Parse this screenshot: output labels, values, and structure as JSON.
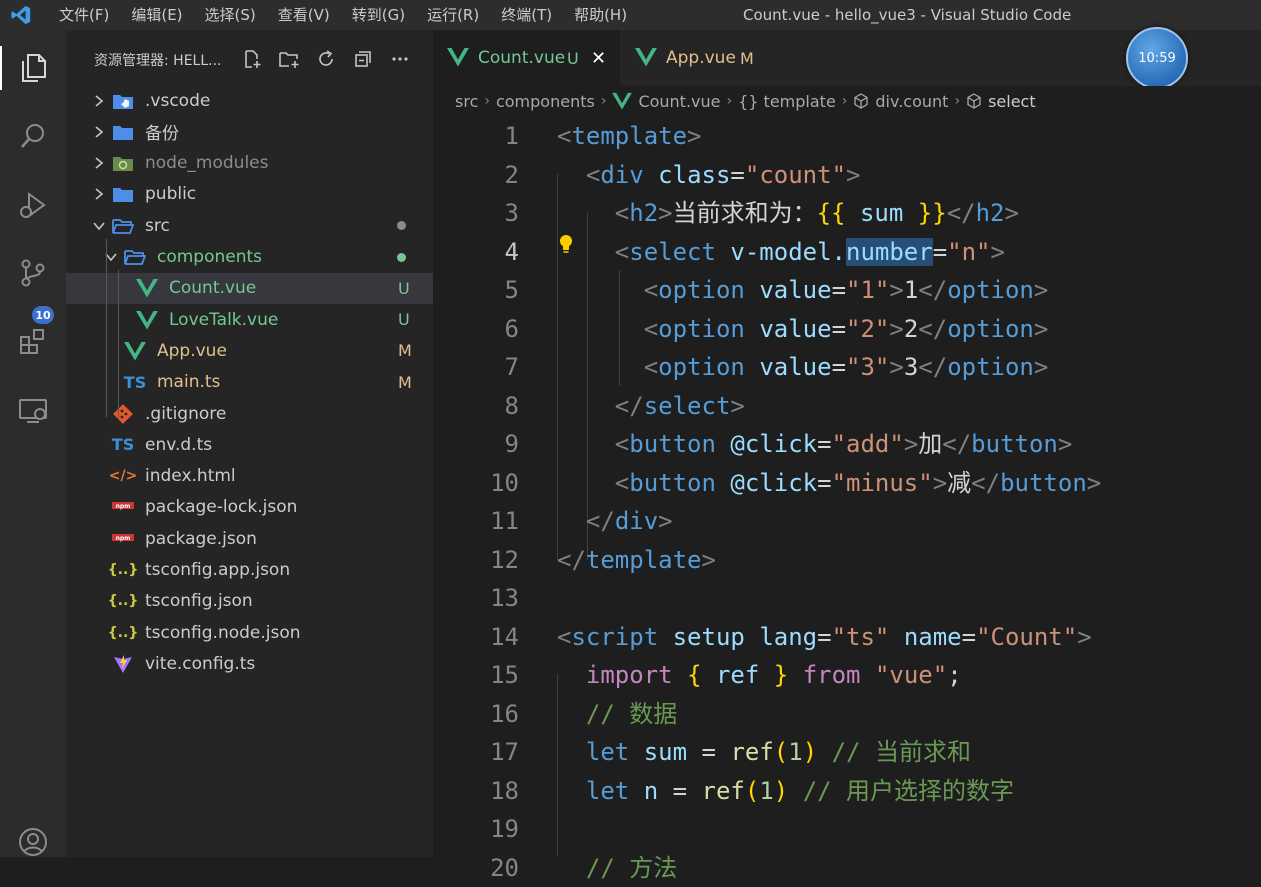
{
  "titlebar": {
    "menu": [
      "文件(F)",
      "编辑(E)",
      "选择(S)",
      "查看(V)",
      "转到(G)",
      "运行(R)",
      "终端(T)",
      "帮助(H)"
    ],
    "window_title": "Count.vue - hello_vue3 - Visual Studio Code"
  },
  "activitybar": {
    "icons": [
      "explorer-icon",
      "search-icon",
      "run-debug-icon",
      "source-control-icon",
      "extensions-icon",
      "remote-explorer-icon",
      "accounts-icon"
    ],
    "scm_badge": "10"
  },
  "sidebar": {
    "title": "资源管理器: HELL...",
    "tree": [
      {
        "label": ".vscode",
        "kind": "folder",
        "icon": "vscode-folder-icon",
        "status": ""
      },
      {
        "label": "备份",
        "kind": "folder",
        "icon": "folder-icon",
        "status": ""
      },
      {
        "label": "node_modules",
        "kind": "folder",
        "icon": "node-folder-icon",
        "status": ""
      },
      {
        "label": "public",
        "kind": "folder",
        "icon": "folder-icon",
        "status": ""
      },
      {
        "label": "src",
        "kind": "folder-open",
        "icon": "folder-open-icon",
        "status": "dot"
      },
      {
        "label": "components",
        "kind": "folder-open",
        "icon": "folder-open-icon",
        "status": "dot"
      },
      {
        "label": "Count.vue",
        "kind": "file",
        "icon": "vue-icon",
        "status": "U"
      },
      {
        "label": "LoveTalk.vue",
        "kind": "file",
        "icon": "vue-icon",
        "status": "U"
      },
      {
        "label": "App.vue",
        "kind": "file",
        "icon": "vue-icon",
        "status": "M"
      },
      {
        "label": "main.ts",
        "kind": "file",
        "icon": "ts-icon",
        "status": "M"
      },
      {
        "label": ".gitignore",
        "kind": "file",
        "icon": "git-icon",
        "status": ""
      },
      {
        "label": "env.d.ts",
        "kind": "file",
        "icon": "ts-icon",
        "status": ""
      },
      {
        "label": "index.html",
        "kind": "file",
        "icon": "html-icon",
        "status": ""
      },
      {
        "label": "package-lock.json",
        "kind": "file",
        "icon": "npm-icon",
        "status": ""
      },
      {
        "label": "package.json",
        "kind": "file",
        "icon": "npm-icon",
        "status": ""
      },
      {
        "label": "tsconfig.app.json",
        "kind": "file",
        "icon": "json-icon",
        "status": ""
      },
      {
        "label": "tsconfig.json",
        "kind": "file",
        "icon": "json-icon",
        "status": ""
      },
      {
        "label": "tsconfig.node.json",
        "kind": "file",
        "icon": "json-icon",
        "status": ""
      },
      {
        "label": "vite.config.ts",
        "kind": "file",
        "icon": "vite-icon",
        "status": ""
      }
    ],
    "selected": "Count.vue"
  },
  "tabs": [
    {
      "label": "Count.vue",
      "status": "U",
      "close": "✕",
      "active": true
    },
    {
      "label": "App.vue",
      "status": "M",
      "active": false
    }
  ],
  "breadcrumb": [
    "src",
    "components",
    "Count.vue",
    "{} template",
    "div.count",
    "select"
  ],
  "clock": "10:59",
  "editor": {
    "current_line": 4,
    "lines": [
      {
        "n": "1",
        "tokens": [
          [
            "bracket",
            "<"
          ],
          [
            "tag",
            "template"
          ],
          [
            "bracket",
            ">"
          ]
        ]
      },
      {
        "n": "2",
        "tokens": [
          [
            "op",
            "  "
          ],
          [
            "bracket",
            "<"
          ],
          [
            "tag",
            "div"
          ],
          [
            "op",
            " "
          ],
          [
            "attr",
            "class"
          ],
          [
            "op",
            "="
          ],
          [
            "str",
            "\"count\""
          ],
          [
            "bracket",
            ">"
          ]
        ]
      },
      {
        "n": "3",
        "tokens": [
          [
            "op",
            "    "
          ],
          [
            "bracket",
            "<"
          ],
          [
            "tag",
            "h2"
          ],
          [
            "bracket",
            ">"
          ],
          [
            "op",
            "当前求和为："
          ],
          [
            "brace",
            "{{"
          ],
          [
            "op",
            " "
          ],
          [
            "var",
            "sum"
          ],
          [
            "op",
            " "
          ],
          [
            "brace",
            "}}"
          ],
          [
            "bracket",
            "</"
          ],
          [
            "tag",
            "h2"
          ],
          [
            "bracket",
            ">"
          ]
        ]
      },
      {
        "n": "4",
        "tokens": [
          [
            "op",
            "    "
          ],
          [
            "bracket",
            "<"
          ],
          [
            "tag",
            "select"
          ],
          [
            "op",
            " "
          ],
          [
            "attr",
            "v-model."
          ],
          [
            "sel",
            "number"
          ],
          [
            "op",
            "="
          ],
          [
            "str",
            "\"n\""
          ],
          [
            "bracket",
            ">"
          ]
        ]
      },
      {
        "n": "5",
        "tokens": [
          [
            "op",
            "      "
          ],
          [
            "bracket",
            "<"
          ],
          [
            "tag",
            "option"
          ],
          [
            "op",
            " "
          ],
          [
            "attr",
            "value"
          ],
          [
            "op",
            "="
          ],
          [
            "str",
            "\"1\""
          ],
          [
            "bracket",
            ">"
          ],
          [
            "op",
            "1"
          ],
          [
            "bracket",
            "</"
          ],
          [
            "tag",
            "option"
          ],
          [
            "bracket",
            ">"
          ]
        ]
      },
      {
        "n": "6",
        "tokens": [
          [
            "op",
            "      "
          ],
          [
            "bracket",
            "<"
          ],
          [
            "tag",
            "option"
          ],
          [
            "op",
            " "
          ],
          [
            "attr",
            "value"
          ],
          [
            "op",
            "="
          ],
          [
            "str",
            "\"2\""
          ],
          [
            "bracket",
            ">"
          ],
          [
            "op",
            "2"
          ],
          [
            "bracket",
            "</"
          ],
          [
            "tag",
            "option"
          ],
          [
            "bracket",
            ">"
          ]
        ]
      },
      {
        "n": "7",
        "tokens": [
          [
            "op",
            "      "
          ],
          [
            "bracket",
            "<"
          ],
          [
            "tag",
            "option"
          ],
          [
            "op",
            " "
          ],
          [
            "attr",
            "value"
          ],
          [
            "op",
            "="
          ],
          [
            "str",
            "\"3\""
          ],
          [
            "bracket",
            ">"
          ],
          [
            "op",
            "3"
          ],
          [
            "bracket",
            "</"
          ],
          [
            "tag",
            "option"
          ],
          [
            "bracket",
            ">"
          ]
        ]
      },
      {
        "n": "8",
        "tokens": [
          [
            "op",
            "    "
          ],
          [
            "bracket",
            "</"
          ],
          [
            "tag",
            "select"
          ],
          [
            "bracket",
            ">"
          ]
        ]
      },
      {
        "n": "9",
        "tokens": [
          [
            "op",
            "    "
          ],
          [
            "bracket",
            "<"
          ],
          [
            "tag",
            "button"
          ],
          [
            "op",
            " "
          ],
          [
            "attr",
            "@click"
          ],
          [
            "op",
            "="
          ],
          [
            "str",
            "\"add\""
          ],
          [
            "bracket",
            ">"
          ],
          [
            "op",
            "加"
          ],
          [
            "bracket",
            "</"
          ],
          [
            "tag",
            "button"
          ],
          [
            "bracket",
            ">"
          ]
        ]
      },
      {
        "n": "10",
        "tokens": [
          [
            "op",
            "    "
          ],
          [
            "bracket",
            "<"
          ],
          [
            "tag",
            "button"
          ],
          [
            "op",
            " "
          ],
          [
            "attr",
            "@click"
          ],
          [
            "op",
            "="
          ],
          [
            "str",
            "\"minus\""
          ],
          [
            "bracket",
            ">"
          ],
          [
            "op",
            "减"
          ],
          [
            "bracket",
            "</"
          ],
          [
            "tag",
            "button"
          ],
          [
            "bracket",
            ">"
          ]
        ]
      },
      {
        "n": "11",
        "tokens": [
          [
            "op",
            "  "
          ],
          [
            "bracket",
            "</"
          ],
          [
            "tag",
            "div"
          ],
          [
            "bracket",
            ">"
          ]
        ]
      },
      {
        "n": "12",
        "tokens": [
          [
            "bracket",
            "</"
          ],
          [
            "tag",
            "template"
          ],
          [
            "bracket",
            ">"
          ]
        ]
      },
      {
        "n": "13",
        "tokens": []
      },
      {
        "n": "14",
        "tokens": [
          [
            "bracket",
            "<"
          ],
          [
            "tag",
            "script"
          ],
          [
            "op",
            " "
          ],
          [
            "attr",
            "setup"
          ],
          [
            "op",
            " "
          ],
          [
            "attr",
            "lang"
          ],
          [
            "op",
            "="
          ],
          [
            "str",
            "\"ts\""
          ],
          [
            "op",
            " "
          ],
          [
            "attr",
            "name"
          ],
          [
            "op",
            "="
          ],
          [
            "str",
            "\"Count\""
          ],
          [
            "bracket",
            ">"
          ]
        ]
      },
      {
        "n": "15",
        "tokens": [
          [
            "op",
            "  "
          ],
          [
            "kw",
            "import"
          ],
          [
            "op",
            " "
          ],
          [
            "brace",
            "{"
          ],
          [
            "op",
            " "
          ],
          [
            "var",
            "ref"
          ],
          [
            "op",
            " "
          ],
          [
            "brace",
            "}"
          ],
          [
            "op",
            " "
          ],
          [
            "kw",
            "from"
          ],
          [
            "op",
            " "
          ],
          [
            "str",
            "\"vue\""
          ],
          [
            "op",
            ";"
          ]
        ]
      },
      {
        "n": "16",
        "tokens": [
          [
            "op",
            "  "
          ],
          [
            "comment",
            "// 数据"
          ]
        ]
      },
      {
        "n": "17",
        "tokens": [
          [
            "op",
            "  "
          ],
          [
            "decl",
            "let"
          ],
          [
            "op",
            " "
          ],
          [
            "var",
            "sum"
          ],
          [
            "op",
            " = "
          ],
          [
            "fn",
            "ref"
          ],
          [
            "brace",
            "("
          ],
          [
            "num",
            "1"
          ],
          [
            "brace",
            ")"
          ],
          [
            "op",
            " "
          ],
          [
            "comment",
            "// 当前求和"
          ]
        ]
      },
      {
        "n": "18",
        "tokens": [
          [
            "op",
            "  "
          ],
          [
            "decl",
            "let"
          ],
          [
            "op",
            " "
          ],
          [
            "var",
            "n"
          ],
          [
            "op",
            " = "
          ],
          [
            "fn",
            "ref"
          ],
          [
            "brace",
            "("
          ],
          [
            "num",
            "1"
          ],
          [
            "brace",
            ")"
          ],
          [
            "op",
            " "
          ],
          [
            "comment",
            "// 用户选择的数字"
          ]
        ]
      },
      {
        "n": "19",
        "tokens": []
      },
      {
        "n": "20",
        "tokens": [
          [
            "op",
            "  "
          ],
          [
            "comment",
            "// 方法"
          ]
        ]
      }
    ]
  }
}
